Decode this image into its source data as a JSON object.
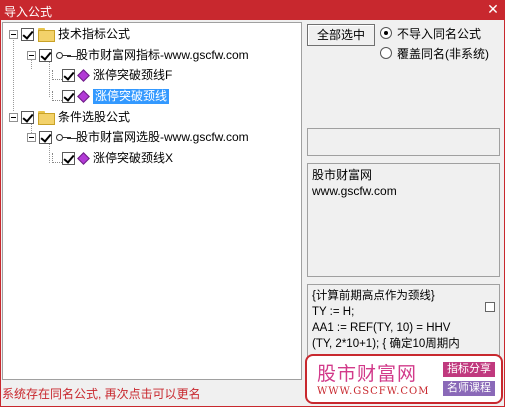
{
  "window": {
    "title": "导入公式",
    "close_glyph": "✕"
  },
  "tree": {
    "groups": [
      {
        "label": "技术指标公式",
        "children": [
          {
            "label": "股市财富网指标-www.gscfw.com",
            "items": [
              "涨停突破颈线F",
              "涨停突破颈线"
            ]
          }
        ]
      },
      {
        "label": "条件选股公式",
        "children": [
          {
            "label": "股市财富网选股-www.gscfw.com",
            "items": [
              "涨停突破颈线X"
            ]
          }
        ]
      }
    ],
    "selected_item": "涨停突破颈线"
  },
  "options": {
    "select_all_label": "全部选中",
    "radio_no_import": "不导入同名公式",
    "radio_overwrite": "覆盖同名(非系统)",
    "selected_radio": "不导入同名公式"
  },
  "author": {
    "name": "股市财富网",
    "site": "www.gscfw.com"
  },
  "code": {
    "lines": [
      "{计算前期高点作为颈线}",
      "TY := H;",
      "AA1 := REF(TY, 10) = HHV",
      "(TY, 2*10+1);  { 确定10周期内"
    ]
  },
  "status": {
    "message": "系统存在同名公式, 再次点击可以更名"
  },
  "watermark": {
    "brand": "股市财富网",
    "site": "WWW.GSCFW.COM",
    "tag1": "指标分享",
    "tag2": "名师课程"
  },
  "icons": [
    "close-icon",
    "folder-icon",
    "key-icon",
    "formula-icon",
    "checkbox-icon"
  ]
}
